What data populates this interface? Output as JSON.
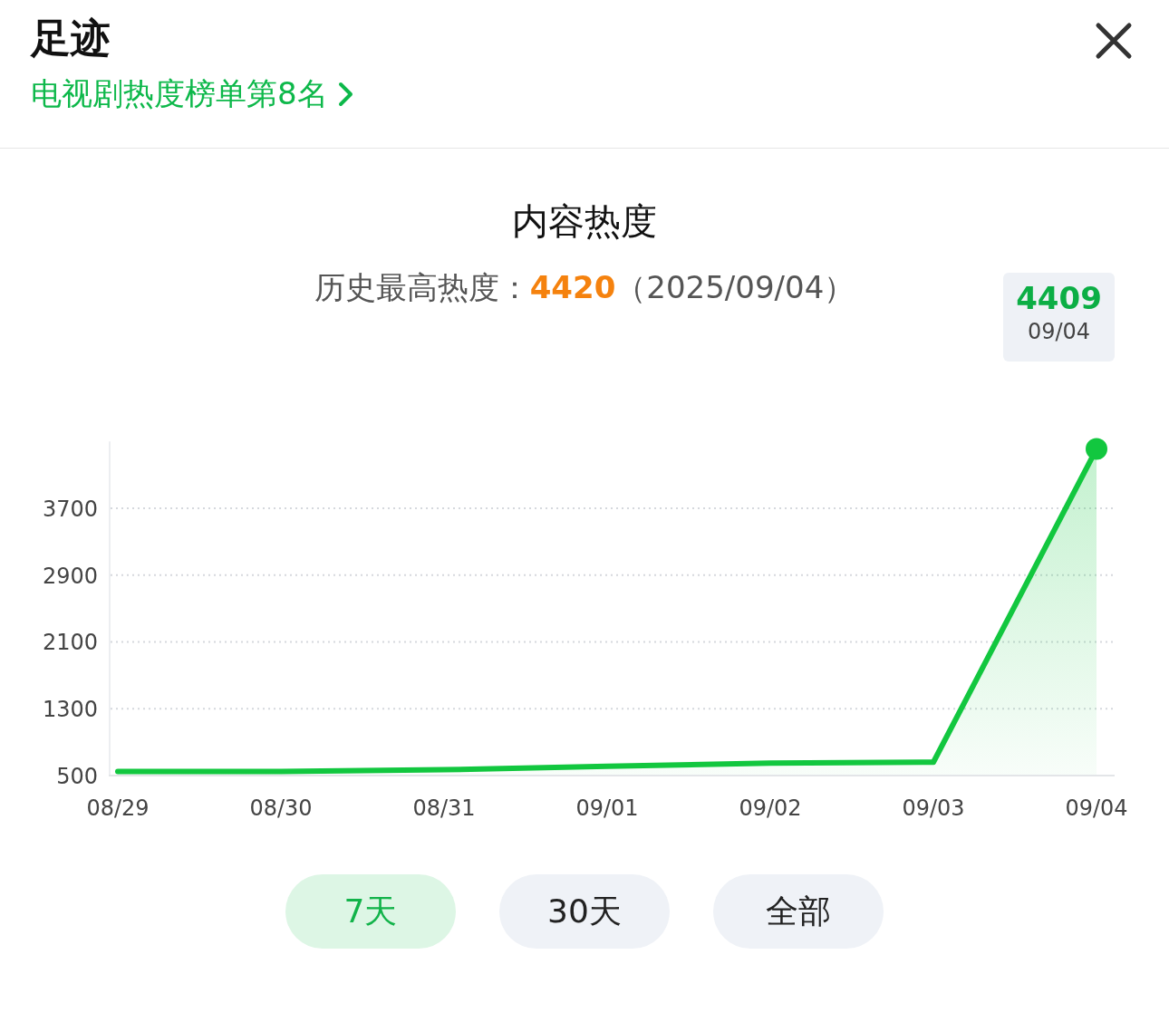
{
  "header": {
    "title": "足迹",
    "rank_link": "电视剧热度榜单第8名"
  },
  "heat": {
    "chart_data": {
      "type": "area",
      "title": "内容热度",
      "categories": [
        "08/29",
        "08/30",
        "08/31",
        "09/01",
        "09/02",
        "09/03",
        "09/04"
      ],
      "series": [
        {
          "color": "#12c73f",
          "values": [
            550,
            550,
            570,
            610,
            650,
            660,
            4409
          ]
        }
      ],
      "ylim": [
        500,
        4500
      ],
      "yticks": [
        500,
        1300,
        2100,
        2900,
        3700
      ],
      "grid": true
    },
    "peak": {
      "label": "历史最高热度：",
      "value": "4420",
      "date": "（2025/09/04）"
    },
    "tooltip": {
      "value": "4409",
      "date": "09/04"
    }
  },
  "ranges": [
    {
      "label": "7天",
      "selected": true
    },
    {
      "label": "30天",
      "selected": false
    },
    {
      "label": "全部",
      "selected": false
    }
  ]
}
